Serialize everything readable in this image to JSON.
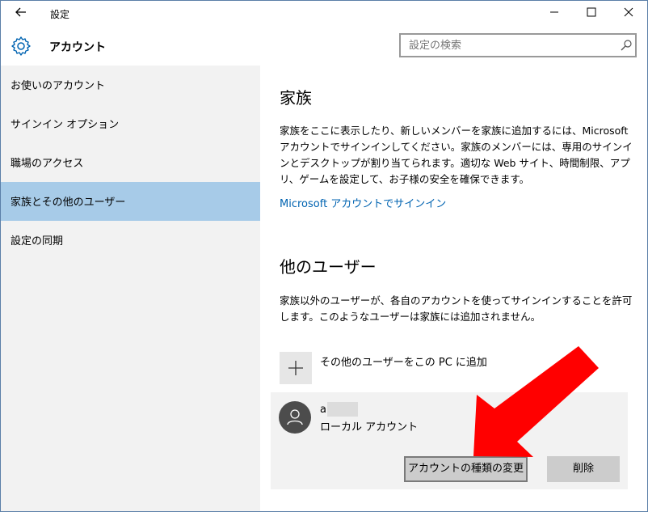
{
  "titlebar": {
    "back_icon": "back-arrow-icon",
    "title": "設定",
    "minimize_icon": "minimize-icon",
    "maximize_icon": "maximize-icon",
    "close_icon": "close-icon"
  },
  "header": {
    "icon": "gear-icon",
    "title": "アカウント",
    "search_placeholder": "設定の検索",
    "search_icon": "search-icon"
  },
  "sidebar": {
    "items": [
      {
        "label": "お使いのアカウント",
        "selected": false
      },
      {
        "label": "サインイン オプション",
        "selected": false
      },
      {
        "label": "職場のアクセス",
        "selected": false
      },
      {
        "label": "家族とその他のユーザー",
        "selected": true
      },
      {
        "label": "設定の同期",
        "selected": false
      }
    ]
  },
  "main": {
    "family": {
      "heading": "家族",
      "description": "家族をここに表示したり、新しいメンバーを家族に追加するには、Microsoft アカウントでサインインしてください。家族のメンバーには、専用のサインインとデスクトップが割り当てられます。適切な Web サイト、時間制限、アプリ、ゲームを設定して、お子様の安全を確保できます。",
      "link": "Microsoft アカウントでサインイン"
    },
    "other_users": {
      "heading": "他のユーザー",
      "description": "家族以外のユーザーが、各自のアカウントを使ってサインインすることを許可します。このようなユーザーは家族には追加されません。",
      "add_label": "その他のユーザーをこの PC に追加",
      "user": {
        "name": "a",
        "type": "ローカル アカウント",
        "change_button": "アカウントの種類の変更",
        "delete_button": "削除"
      }
    }
  },
  "colors": {
    "accent": "#0063b1",
    "selected_nav": "#a7cbe8",
    "annotation_arrow": "#ff0000"
  }
}
